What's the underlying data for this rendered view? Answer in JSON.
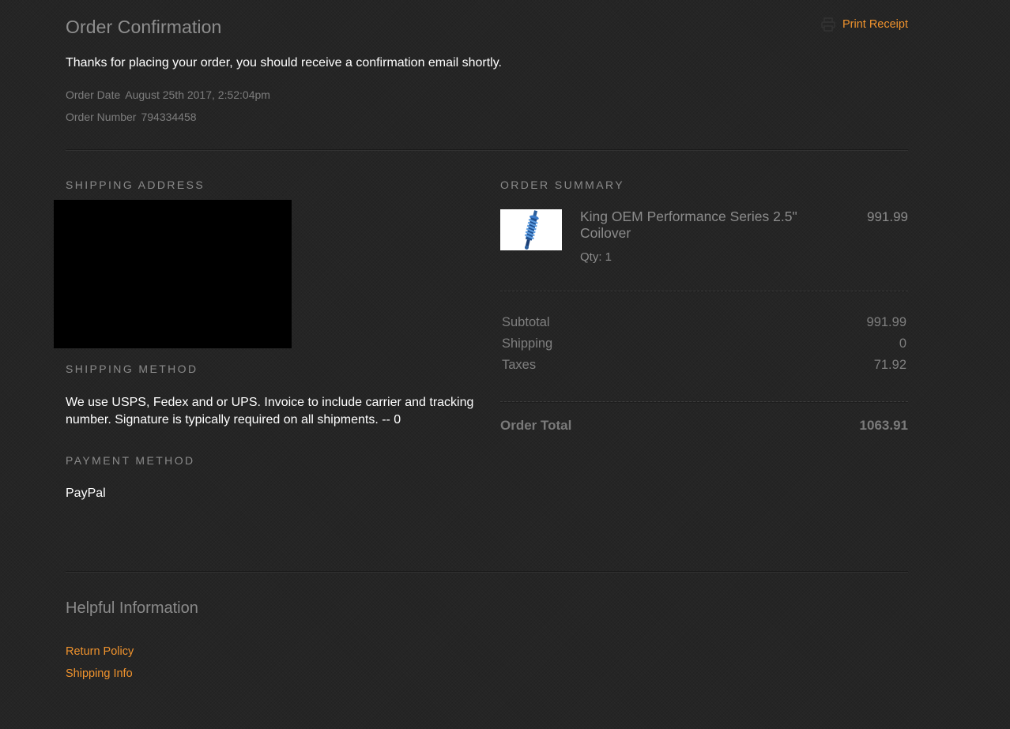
{
  "header": {
    "title": "Order Confirmation",
    "print_label": "Print Receipt",
    "print_icon": "printer-icon",
    "thanks_message": "Thanks for placing your order, you should receive a confirmation email shortly."
  },
  "order": {
    "date_label": "Order Date",
    "date_value": "August 25th 2017, 2:52:04pm",
    "number_label": "Order Number",
    "number_value": "794334458"
  },
  "shipping_address": {
    "label": "SHIPPING ADDRESS"
  },
  "shipping_method": {
    "label": "SHIPPING METHOD",
    "text": "We use USPS, Fedex and or UPS. Invoice to include carrier and tracking number. Signature is typically required on all shipments. -- 0"
  },
  "payment_method": {
    "label": "PAYMENT METHOD",
    "value": "PayPal"
  },
  "order_summary": {
    "label": "ORDER SUMMARY",
    "items": [
      {
        "name": "King OEM Performance Series 2.5\" Coilover",
        "price": "991.99",
        "qty": "Qty: 1"
      }
    ],
    "subtotal_label": "Subtotal",
    "subtotal_value": "991.99",
    "shipping_label": "Shipping",
    "shipping_value": "0",
    "taxes_label": "Taxes",
    "taxes_value": "71.92",
    "total_label": "Order Total",
    "total_value": "1063.91"
  },
  "helpful": {
    "title": "Helpful Information",
    "links": [
      "Return Policy",
      "Shipping Info"
    ]
  },
  "colors": {
    "accent": "#f0932d",
    "background": "#252525",
    "muted_text": "#8a8a8a"
  }
}
